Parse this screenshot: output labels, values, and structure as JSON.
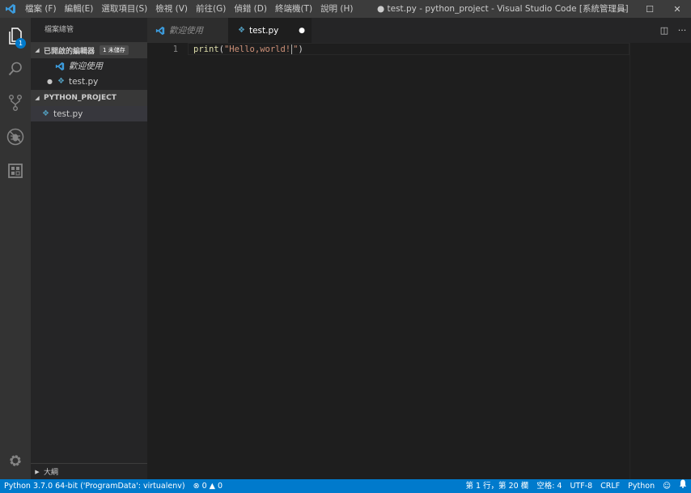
{
  "titlebar": {
    "menu": [
      "檔案 (F)",
      "編輯(E)",
      "選取項目(S)",
      "檢視 (V)",
      "前往(G)",
      "偵錯 (D)",
      "終端機(T)",
      "說明 (H)"
    ],
    "window_title": "● test.py - python_project - Visual Studio Code [系統管理員]",
    "minimize_glyph": "—",
    "maximize_glyph": "☐",
    "close_glyph": "✕"
  },
  "activitybar": {
    "explorer_badge": "1",
    "icons": [
      "files-icon",
      "search-icon",
      "source-control-icon",
      "debug-icon",
      "extensions-icon",
      "settings-gear-icon"
    ]
  },
  "sidebar": {
    "title": "檔案總管",
    "open_editors": {
      "header": "已開啟的編輯器",
      "dirty_badge": "1 未儲存",
      "items": [
        {
          "label": "歡迎使用",
          "type": "welcome"
        },
        {
          "label": "test.py",
          "type": "python",
          "dirty": true
        }
      ]
    },
    "project": {
      "header": "PYTHON_PROJECT",
      "files": [
        {
          "label": "test.py"
        }
      ]
    },
    "outline_label": "大綱"
  },
  "tabs": [
    {
      "label": "歡迎使用",
      "active": false
    },
    {
      "label": "test.py",
      "active": true,
      "dirty_dot": "●"
    }
  ],
  "tab_actions": {
    "split": "◫",
    "more": "···"
  },
  "editor": {
    "lines": [
      {
        "number": "1",
        "tokens": {
          "fn": "print",
          "open": "(",
          "str_before_cursor": "\"Hello,world!",
          "str_after_cursor": "\"",
          "close": ")"
        }
      }
    ]
  },
  "statusbar": {
    "interpreter": "Python 3.7.0 64-bit ('ProgramData': virtualenv)",
    "errors": "0",
    "warnings": "0",
    "position": "第 1 行，第 20 欄",
    "indent": "空格: 4",
    "encoding": "UTF-8",
    "eol": "CRLF",
    "language": "Python"
  },
  "colors": {
    "accent": "#007acc",
    "python_icon": "#519aba",
    "string": "#ce9178",
    "function": "#dcdcaa"
  }
}
